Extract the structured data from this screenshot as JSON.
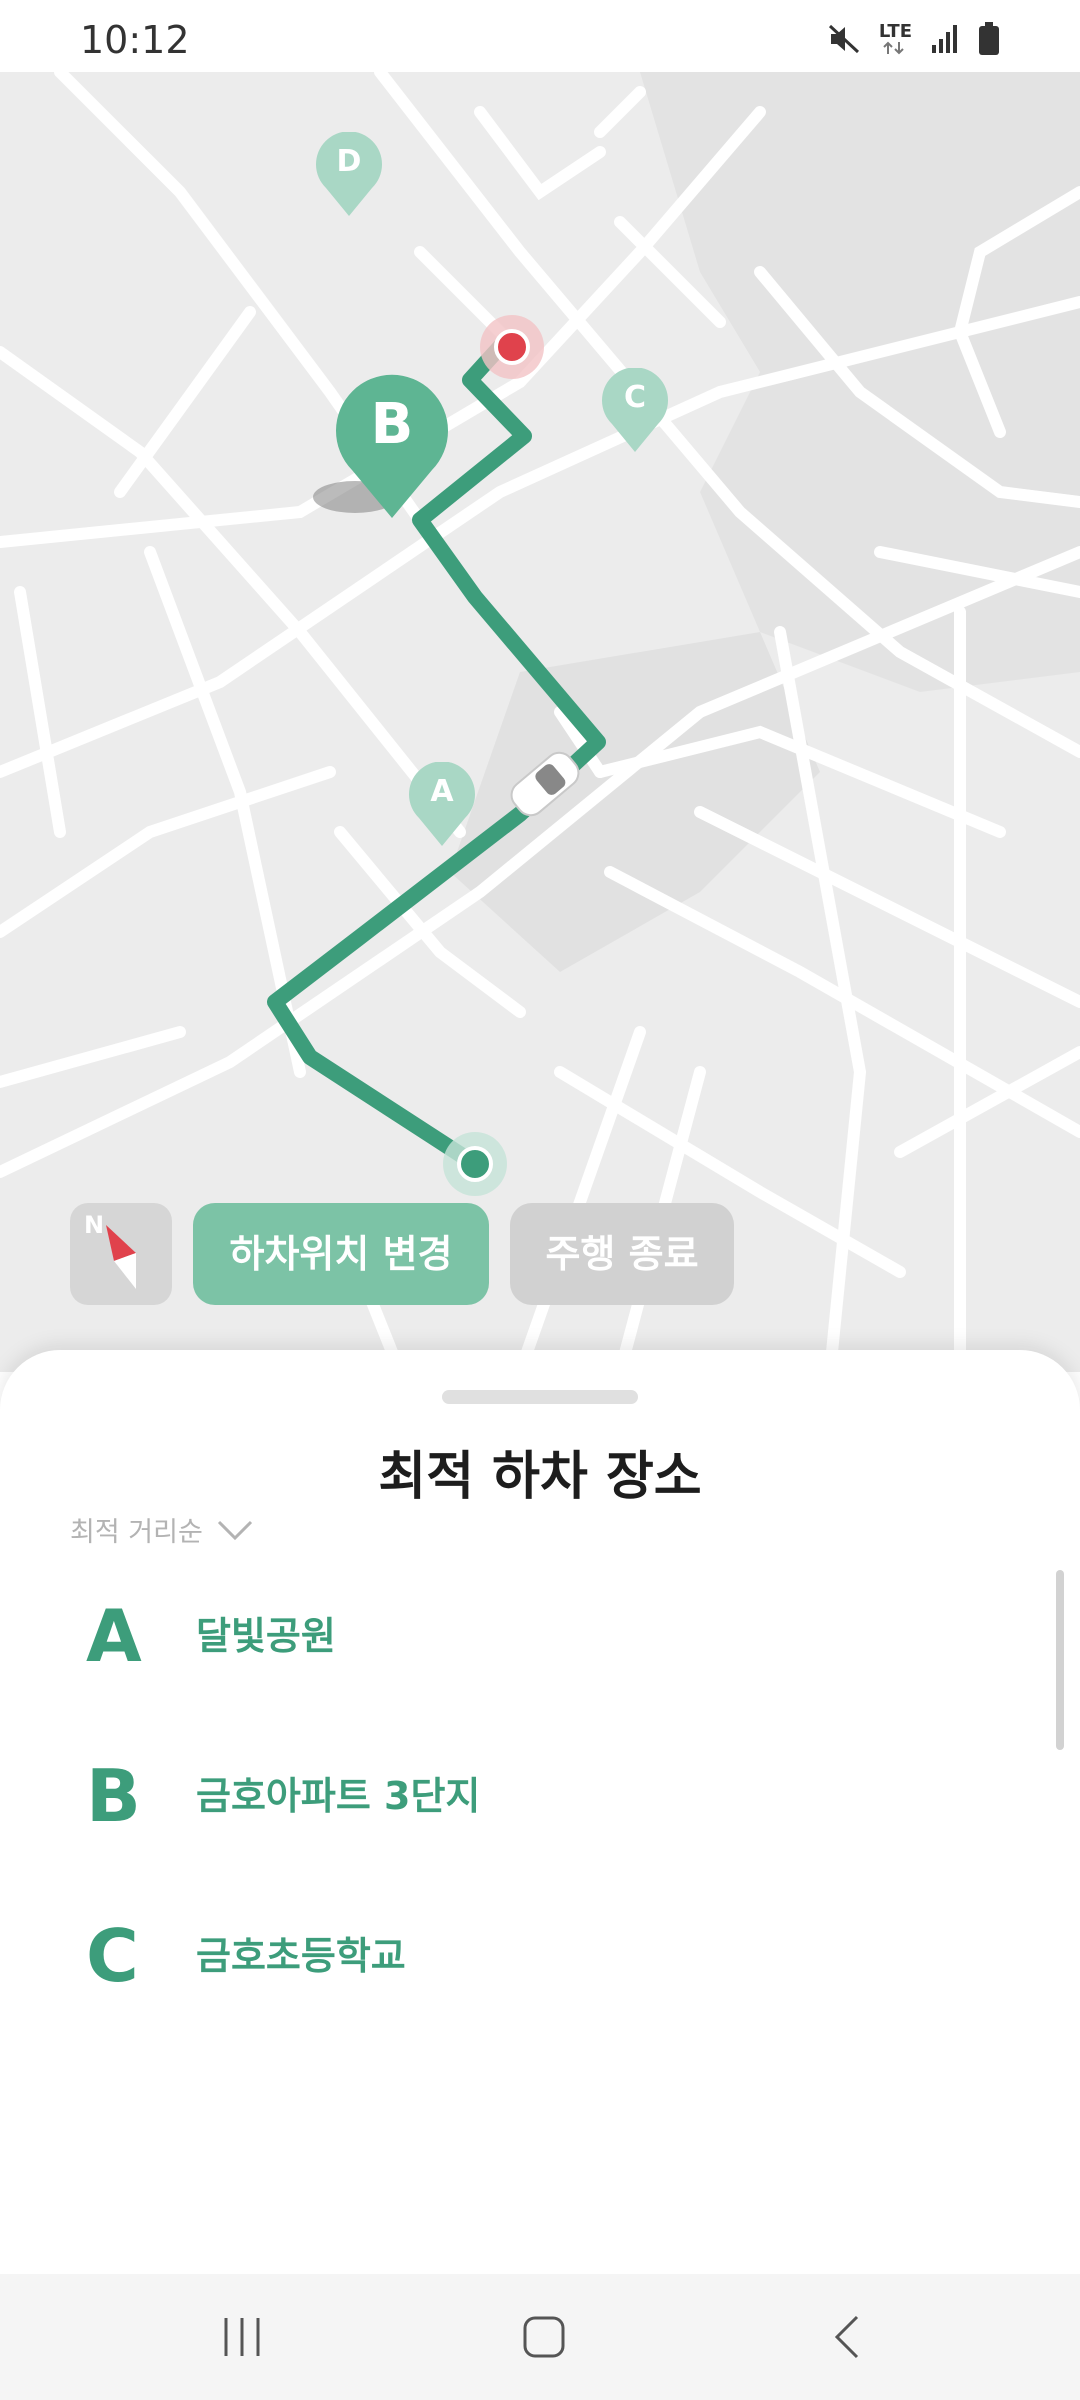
{
  "status_bar": {
    "time": "10:12",
    "network_label": "LTE",
    "icons": [
      "mute-icon",
      "lte-icon",
      "signal-icon",
      "battery-icon"
    ]
  },
  "map": {
    "pins": [
      {
        "label": "D"
      },
      {
        "label": "B"
      },
      {
        "label": "C"
      },
      {
        "label": "A"
      }
    ],
    "compass_label": "N",
    "route_color": "#3d9d7b",
    "destination_color": "#e0424c"
  },
  "map_controls": {
    "change_dropoff_label": "하차위치 변경",
    "end_drive_label": "주행 종료"
  },
  "sheet": {
    "title": "최적 하차 장소",
    "sort_label": "최적 거리순",
    "items": [
      {
        "letter": "A",
        "name": "달빛공원"
      },
      {
        "letter": "B",
        "name": "금호아파트 3단지"
      },
      {
        "letter": "C",
        "name": "금호초등학교"
      }
    ]
  },
  "colors": {
    "accent": "#3d9d7b",
    "button_active": "#7cc3a6",
    "button_disabled": "#d1d1d1"
  }
}
